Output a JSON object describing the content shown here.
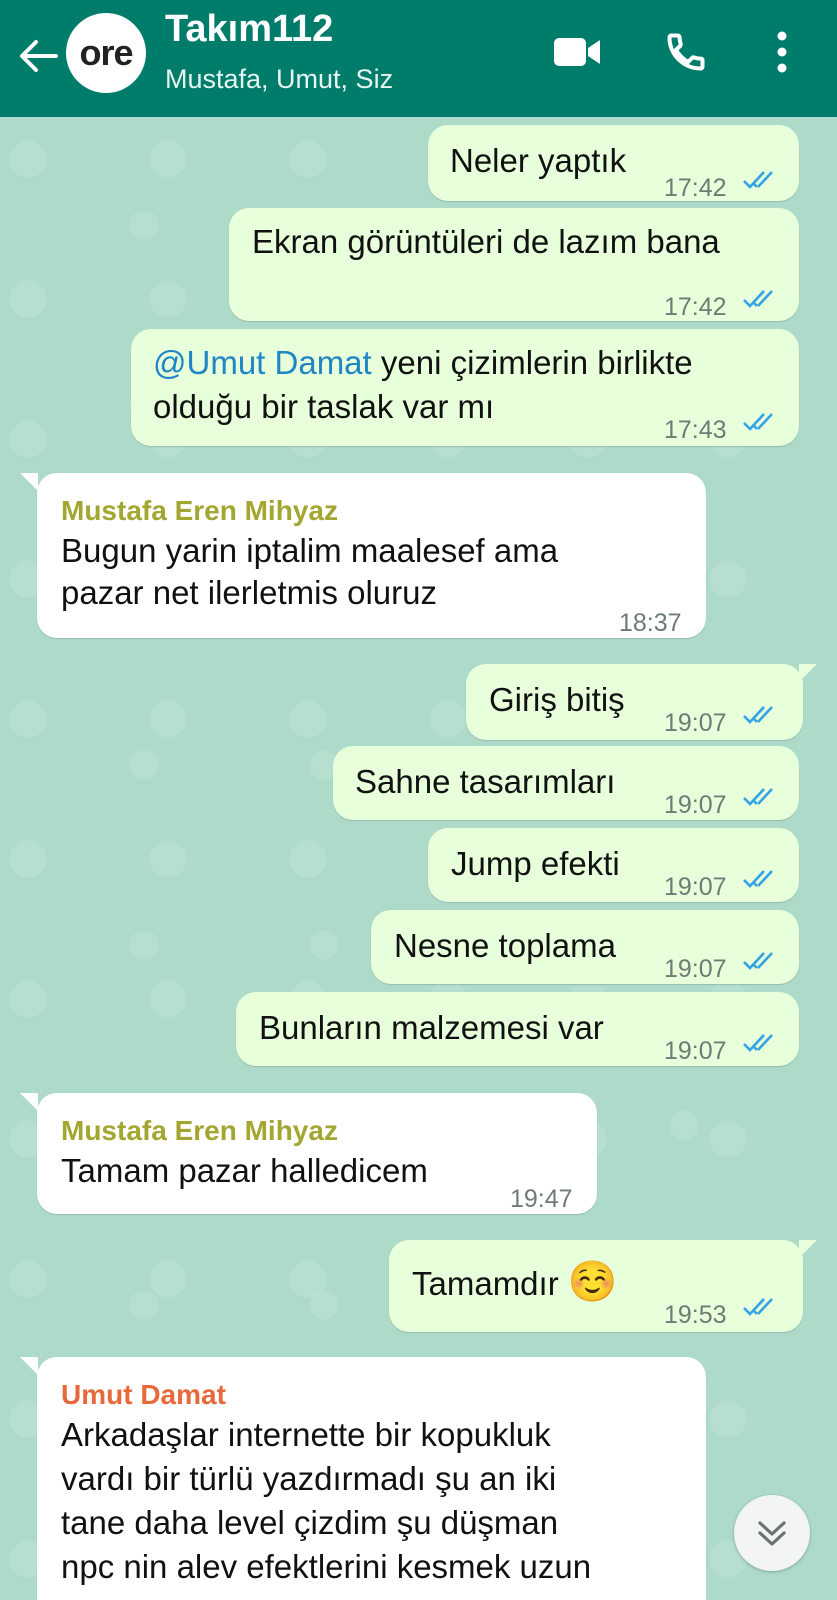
{
  "header": {
    "avatar_text": "ore",
    "title": "Takım112",
    "subtitle": "Mustafa, Umut, Siz"
  },
  "colors": {
    "header_bg": "#007c6b",
    "chat_bg": "#aedbc9",
    "outgoing_bubble": "#e7ffdb",
    "incoming_bubble": "#ffffff",
    "read_ticks": "#33a3e6",
    "sender_mustafa": "#a3a631",
    "sender_umut": "#e8683a",
    "mention": "#1f86c6"
  },
  "messages": [
    {
      "text": "Neler yaptık",
      "time": "17:42"
    },
    {
      "text": "Ekran görüntüleri de lazım bana",
      "time": "17:42"
    },
    {
      "mention": "@Umut Damat",
      "text1": " yeni çizimlerin birlikte",
      "text2": "olduğu bir taslak var mı",
      "time": "17:43"
    },
    {
      "sender": "Mustafa Eren Mihyaz",
      "line1": "Bugun yarin iptalim maalesef ama",
      "line2": "pazar net ilerletmis oluruz",
      "time": "18:37"
    },
    {
      "text": "Giriş bitiş",
      "time": "19:07"
    },
    {
      "text": "Sahne tasarımları",
      "time": "19:07"
    },
    {
      "text": "Jump efekti",
      "time": "19:07"
    },
    {
      "text": "Nesne toplama",
      "time": "19:07"
    },
    {
      "text": "Bunların malzemesi var",
      "time": "19:07"
    },
    {
      "sender": "Mustafa Eren Mihyaz",
      "text": "Tamam pazar halledicem",
      "time": "19:47"
    },
    {
      "text": "Tamamdır",
      "emoji": "☺️",
      "time": "19:53"
    },
    {
      "sender": "Umut Damat",
      "line1": "Arkadaşlar internette bir kopukluk",
      "line2": "vardı bir türlü yazdırmadı şu an iki",
      "line3": "tane daha level çizdim şu düşman",
      "line4": "npc nin alev efektlerini kesmek uzun"
    }
  ]
}
